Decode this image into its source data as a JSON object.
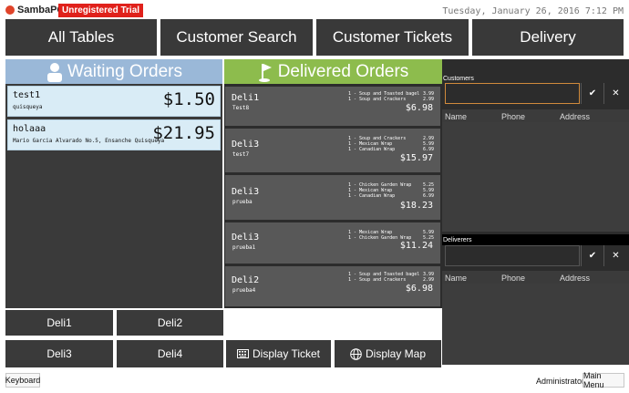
{
  "header": {
    "logo": "SambaPOS",
    "trial_badge": "Unregistered Trial",
    "datetime": "Tuesday, January 26, 2016 7:12 PM"
  },
  "top_buttons": [
    "All Tables",
    "Customer Search",
    "Customer Tickets",
    "Delivery"
  ],
  "waiting": {
    "title": "Waiting Orders",
    "orders": [
      {
        "name": "test1",
        "address": "quisqueya",
        "price": "$1.50"
      },
      {
        "name": "holaaa",
        "address": "Mario Garcia Alvarado No.5, Ensanche Quisqueya",
        "price": "$21.95"
      }
    ]
  },
  "delivered": {
    "title": "Delivered Orders",
    "orders": [
      {
        "name": "Deli1",
        "customer": "Test8",
        "total": "$6.98",
        "lines": [
          {
            "item": "1 - Soup and Toasted bagel",
            "price": "3.99"
          },
          {
            "item": "1 - Soup and Crackers",
            "price": "2.99"
          }
        ]
      },
      {
        "name": "Deli3",
        "customer": "test7",
        "total": "$15.97",
        "lines": [
          {
            "item": "1 - Soup and Crackers",
            "price": "2.99"
          },
          {
            "item": "1 - Mexican Wrap",
            "price": "5.99"
          },
          {
            "item": "1 - Canadian Wrap",
            "price": "6.99"
          }
        ]
      },
      {
        "name": "Deli3",
        "customer": "prueba",
        "total": "$18.23",
        "lines": [
          {
            "item": "1 - Chicken Garden Wrap",
            "price": "5.25"
          },
          {
            "item": "1 - Mexican Wrap",
            "price": "5.99"
          },
          {
            "item": "1 - Canadian Wrap",
            "price": "6.99"
          }
        ]
      },
      {
        "name": "Deli3",
        "customer": "prueba1",
        "total": "$11.24",
        "lines": [
          {
            "item": "1 - Mexican Wrap",
            "price": "5.99"
          },
          {
            "item": "1 - Chicken Garden Wrap",
            "price": "5.25"
          }
        ]
      },
      {
        "name": "Deli2",
        "customer": "prueba4",
        "total": "$6.98",
        "lines": [
          {
            "item": "1 - Soup and Toasted bagel",
            "price": "3.99"
          },
          {
            "item": "1 - Soup and Crackers",
            "price": "2.99"
          }
        ]
      }
    ]
  },
  "bottom_buttons": {
    "deli1": "Deli1",
    "deli2": "Deli2",
    "deli3": "Deli3",
    "deli4": "Deli4",
    "display_ticket": "Display Ticket",
    "display_map": "Display Map"
  },
  "right": {
    "customers_label": "Customers",
    "deliverers_label": "Deliverers",
    "columns": [
      "Name",
      "Phone",
      "Address"
    ],
    "confirm_glyph": "✔",
    "cancel_glyph": "✕"
  },
  "footer": {
    "keyboard": "Keyboard",
    "user": "Administrator",
    "main_menu": "Main Menu"
  },
  "colors": {
    "waiting_header": "#9ab8d8",
    "delivered_header": "#8dbc4d",
    "trial_badge": "#e0211b",
    "tile": "#393939"
  }
}
